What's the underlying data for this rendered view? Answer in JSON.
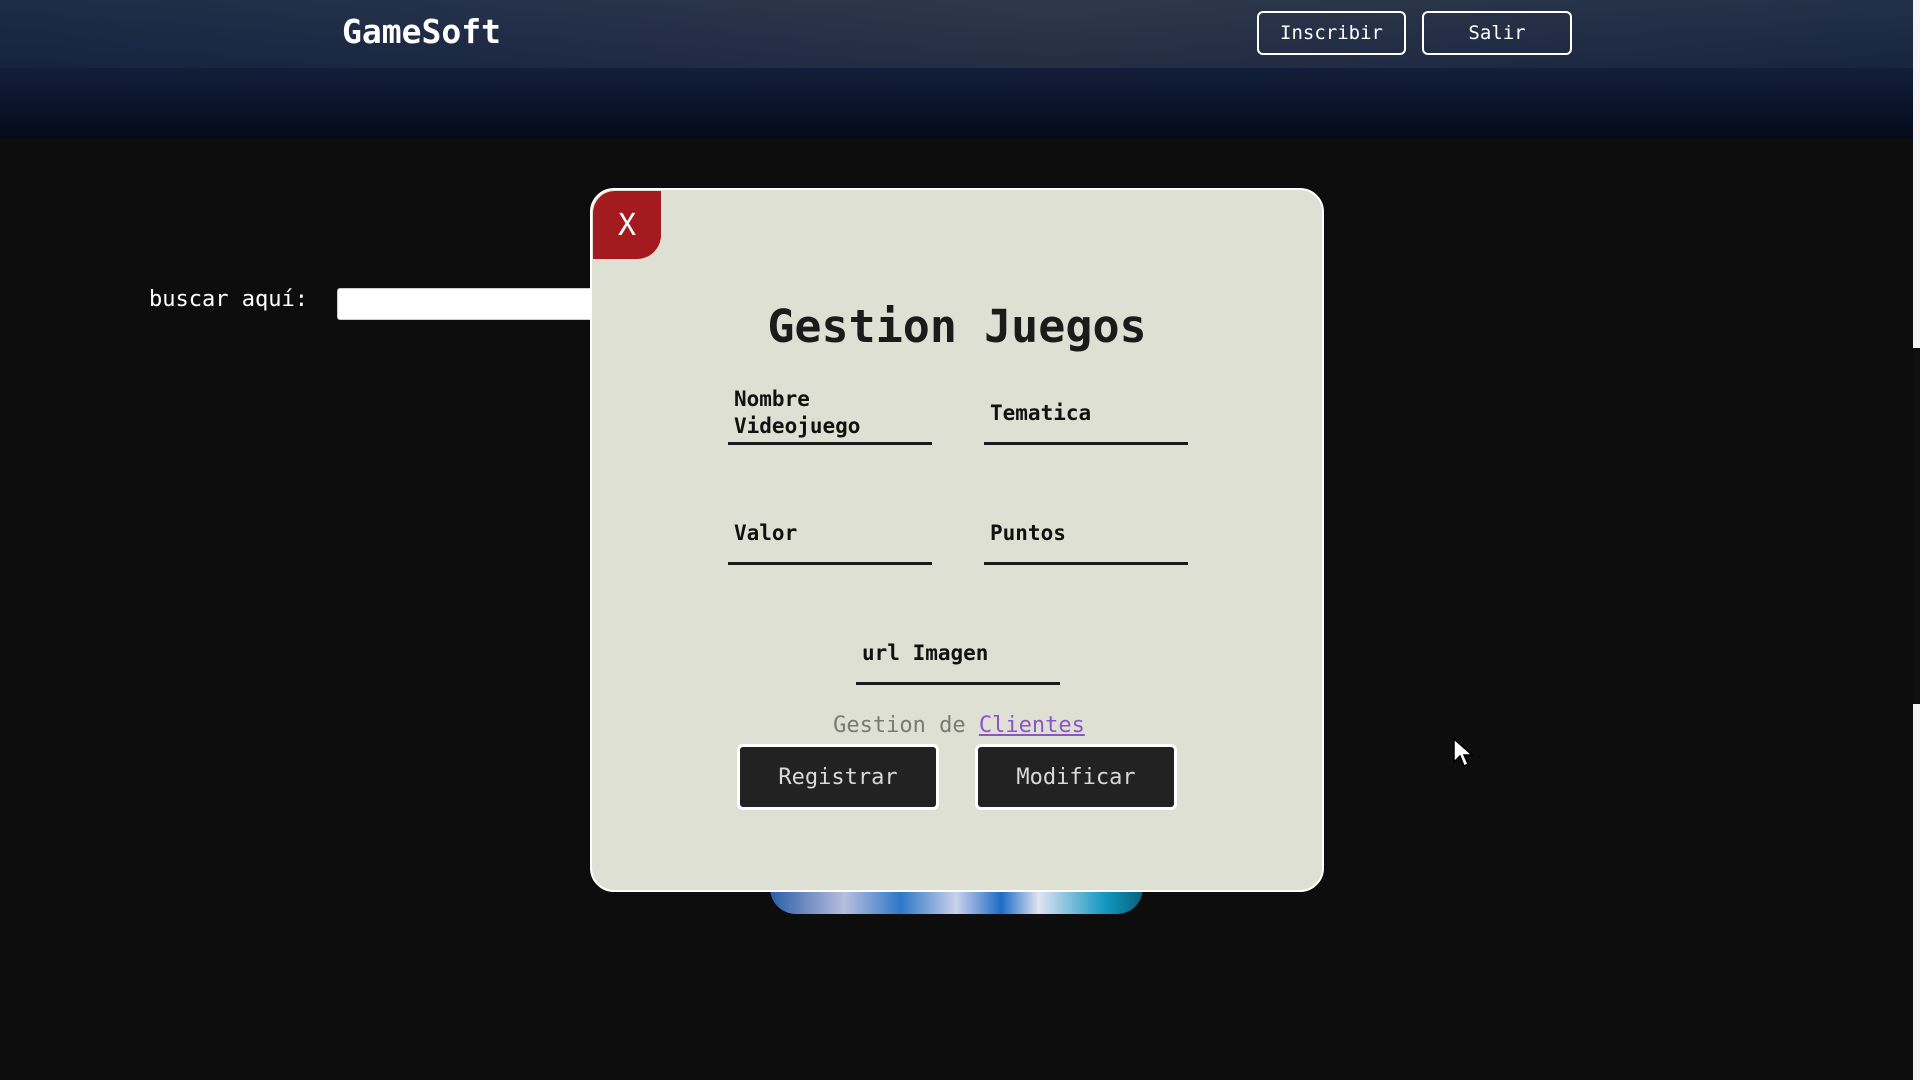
{
  "header": {
    "brand": "GameSoft",
    "inscribir_label": "Inscribir",
    "salir_label": "Salir"
  },
  "search": {
    "label": "buscar aquí:",
    "value": ""
  },
  "modal": {
    "close_label": "X",
    "title": "Gestion Juegos",
    "fields": {
      "nombre": "Nombre Videojuego",
      "tematica": "Tematica",
      "valor": "Valor",
      "puntos": "Puntos",
      "url": "url Imagen"
    },
    "gestion_prefix": "Gestion de",
    "gestion_link": "Clientes",
    "registrar_label": "Registrar",
    "modificar_label": "Modificar"
  },
  "colors": {
    "close_button": "#a31b1f",
    "modal_background": "#dfe0d4",
    "link": "#8a55c8"
  },
  "icons": {
    "cursor": "mouse-pointer-icon"
  }
}
